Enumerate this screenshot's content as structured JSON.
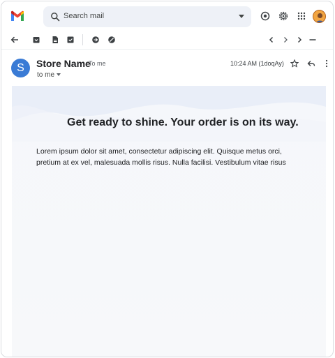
{
  "search": {
    "placeholder": "Search mail"
  },
  "sender": {
    "initial": "S",
    "name": "Store Name",
    "to_badge": "To me",
    "recipients": "to me"
  },
  "message": {
    "time": "10:24 AM (1doqAy)",
    "headline": "Get ready to shine. Your order is on its way.",
    "paragraph": "Lorem ipsum dolor sit amet, consectetur adipiscing elit. Quisque metus orci, pretium at ex vel, malesuada mollis risus. Nulla facilisi. Vestibulum vitae risus"
  },
  "icons": {
    "top": [
      "support-icon",
      "settings-icon",
      "apps-grid-icon",
      "account-avatar"
    ],
    "toolbar": [
      "back-arrow-icon",
      "archive-icon",
      "report-spam-icon",
      "delete-icon",
      "mark-unread-icon",
      "snooze-icon",
      "newer-chevron-icon",
      "older-chevron-icon",
      "next-chevron-icon",
      "minimize-icon"
    ],
    "header": [
      "star-icon",
      "reply-icon",
      "more-vert-icon"
    ]
  },
  "colors": {
    "accent": "#3a7bd5",
    "gmail_red": "#ea4335",
    "gmail_blue": "#4285f4",
    "gmail_green": "#34a853",
    "gmail_yellow": "#fbbc04"
  }
}
